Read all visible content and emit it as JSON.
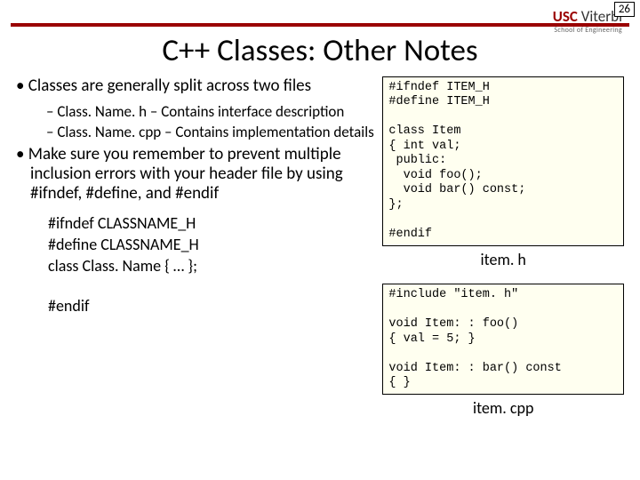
{
  "page_number": "26",
  "logo": {
    "usc": "USC",
    "viterbi": "Viterbi",
    "sub": "School of Engineering"
  },
  "title": "C++ Classes: Other Notes",
  "bullets": {
    "b1": "Classes are generally split across two files",
    "s1": "Class. Name. h – Contains interface description",
    "s2": "Class. Name. cpp – Contains implementation details",
    "b2": "Make sure you remember to prevent multiple inclusion errors with your header file by using #ifndef, #define, and #endif"
  },
  "inline_code": {
    "l1": "#ifndef CLASSNAME_H",
    "l2": "#define CLASSNAME_H",
    "l3": "class Class. Name { … };",
    "l4": "#endif"
  },
  "code_h": "#ifndef ITEM_H\n#define ITEM_H\n\nclass Item\n{ int val;\n public:\n  void foo();\n  void bar() const;\n};\n\n#endif",
  "label_h": "item. h",
  "code_cpp": "#include \"item. h\"\n\nvoid Item: : foo()\n{ val = 5; }\n\nvoid Item: : bar() const\n{ }",
  "label_cpp": "item. cpp"
}
